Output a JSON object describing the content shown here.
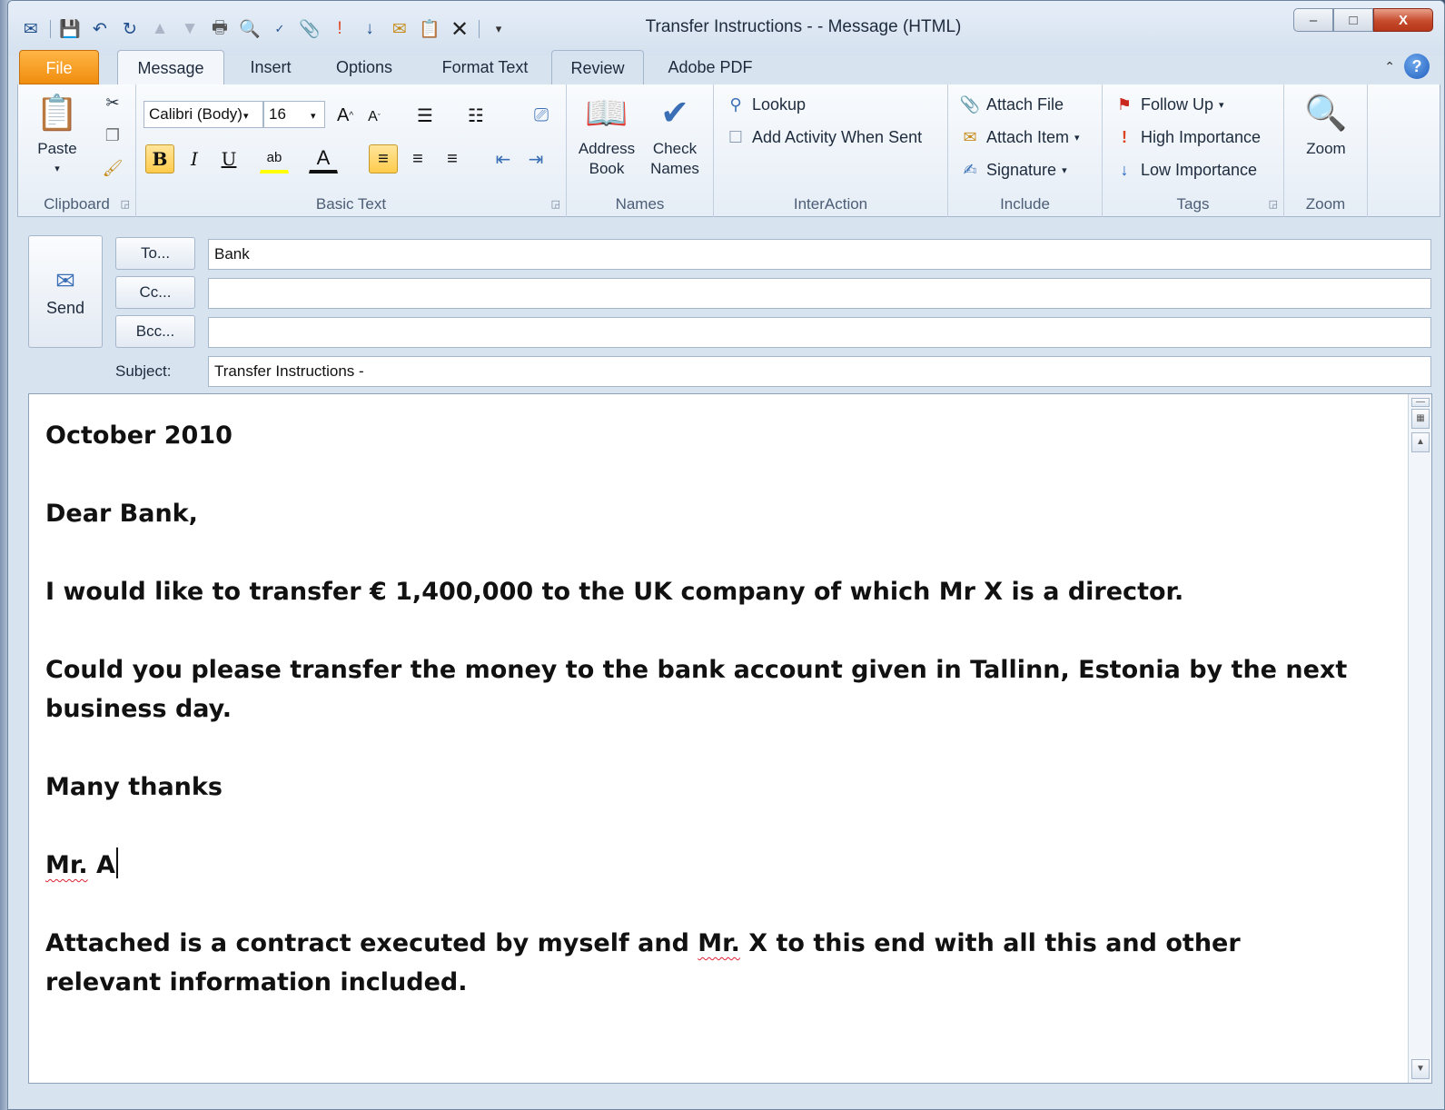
{
  "window": {
    "title": "Transfer Instructions -  - Message (HTML)",
    "controls": {
      "minimize": "–",
      "maximize": "□",
      "close": "X"
    }
  },
  "quick_access": {
    "icons": [
      "outlook-icon",
      "save-icon",
      "undo-icon",
      "redo-icon",
      "previous-icon",
      "next-icon",
      "print-icon",
      "print-preview-icon",
      "spelling-icon",
      "attach-icon",
      "importance-high-icon",
      "importance-low-icon",
      "reply-icon",
      "paste-icon",
      "delete-icon",
      "customize-icon"
    ]
  },
  "tabs": [
    {
      "label": "File"
    },
    {
      "label": "Message"
    },
    {
      "label": "Insert"
    },
    {
      "label": "Options"
    },
    {
      "label": "Format Text"
    },
    {
      "label": "Review"
    },
    {
      "label": "Adobe PDF"
    }
  ],
  "ribbon": {
    "clipboard": {
      "label": "Clipboard",
      "paste": "Paste"
    },
    "basic_text": {
      "label": "Basic Text",
      "font_name": "Calibri (Body)",
      "font_size": "16"
    },
    "names": {
      "label": "Names",
      "address_book": [
        "Address",
        "Book"
      ],
      "check_names": [
        "Check",
        "Names"
      ]
    },
    "interaction": {
      "label": "InterAction",
      "lookup": "Lookup",
      "add_activity": "Add Activity When Sent"
    },
    "include": {
      "label": "Include",
      "attach_file": "Attach File",
      "attach_item": "Attach Item",
      "signature": "Signature"
    },
    "tags": {
      "label": "Tags",
      "follow_up": "Follow Up",
      "high_importance": "High Importance",
      "low_importance": "Low Importance"
    },
    "zoom": {
      "label": "Zoom",
      "zoom": "Zoom"
    }
  },
  "compose": {
    "send": "Send",
    "to_button": "To...",
    "cc_button": "Cc...",
    "bcc_button": "Bcc...",
    "subject_label": "Subject:",
    "to_value": "Bank",
    "cc_value": "",
    "bcc_value": "",
    "subject_value": "Transfer Instructions -"
  },
  "body": {
    "date": "October 2010",
    "greeting": "Dear Bank,",
    "p1": "I would like to transfer € 1,400,000 to the UK company of which Mr X is a director.",
    "p2": "Could you please transfer the money to the bank account given in Tallinn, Estonia by the next business day.",
    "closing": "Many thanks",
    "sig_mr": "Mr.",
    "sig_name": " A",
    "p3_before": "Attached is a contract executed by myself and ",
    "p3_mr": "Mr.",
    "p3_after": " X to this end with all this and other relevant information included."
  }
}
